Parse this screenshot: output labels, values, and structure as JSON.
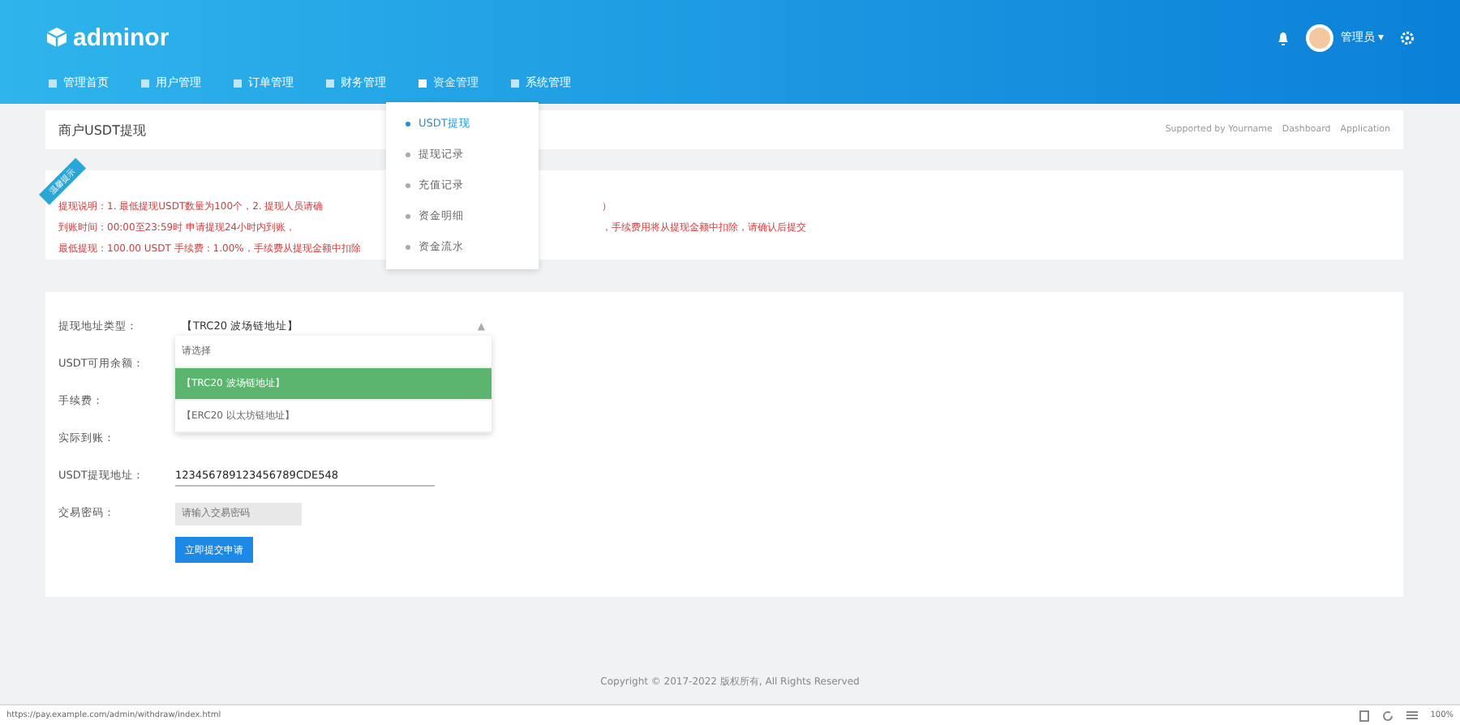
{
  "header": {
    "logo": "adminor",
    "user": "管理员",
    "caret": "▾"
  },
  "nav": [
    {
      "label": "管理首页",
      "selected": false
    },
    {
      "label": "用户管理",
      "selected": false
    },
    {
      "label": "订单管理",
      "selected": false
    },
    {
      "label": "财务管理",
      "selected": false
    },
    {
      "label": "资金管理",
      "selected": true
    },
    {
      "label": "系统管理",
      "selected": false
    }
  ],
  "nav_menu": [
    {
      "label": "USDT提现",
      "selected": true
    },
    {
      "label": "提现记录",
      "selected": false
    },
    {
      "label": "充值记录",
      "selected": false
    },
    {
      "label": "资金明细",
      "selected": false
    },
    {
      "label": "资金流水",
      "selected": false
    }
  ],
  "page": {
    "title": "商户USDT提现",
    "breadcrumb": [
      "Supported by Yourname",
      "Dashboard",
      "Application"
    ]
  },
  "notice": {
    "ribbon": "温馨提示",
    "lines": [
      {
        "left": "提现说明：1. 最低提现USDT数量为100个，2. 提现人员请确",
        "right": "）"
      },
      {
        "left": "到账时间：00:00至23:59时 申请提现24小时内到账，",
        "right": "，手续费用将从提现金额中扣除，请确认后提交"
      },
      {
        "left": "最低提现：100.00 USDT    手续费：1.00%，手续费从提现金额中扣除"
      }
    ]
  },
  "form": {
    "fields": [
      {
        "kind": "select",
        "label": "提现地址类型：",
        "value": "【TRC20 波场链地址】",
        "arrow": "▲"
      },
      {
        "kind": "text",
        "label": "USDT可用余额："
      },
      {
        "kind": "text",
        "label": "手续费："
      },
      {
        "kind": "text",
        "label": "实际到账："
      },
      {
        "kind": "input",
        "label": "USDT提现地址：",
        "value": "123456789123456789CDE548"
      },
      {
        "kind": "password",
        "label": "交易密码：",
        "placeholder": "请输入交易密码",
        "disabled": true
      }
    ],
    "options": [
      {
        "label": "请选择",
        "selected": false
      },
      {
        "label": "【TRC20 波场链地址】",
        "selected": true
      },
      {
        "label": "【ERC20 以太坊链地址】",
        "selected": false
      }
    ],
    "submit": "立即提交申请"
  },
  "footer": "Copyright © 2017-2022 版权所有, All Rights Reserved",
  "status_bar": {
    "url": "https://pay.example.com/admin/withdraw/index.html",
    "zoom": "100%"
  }
}
